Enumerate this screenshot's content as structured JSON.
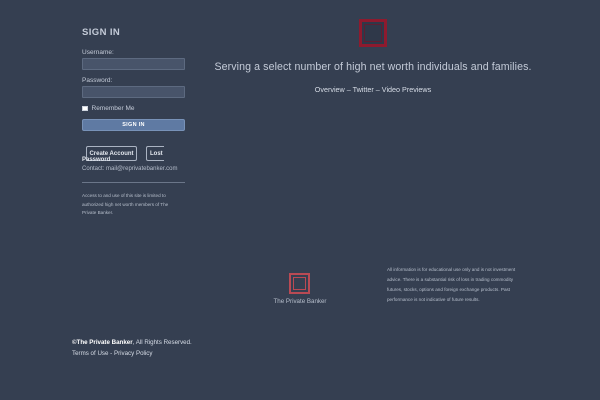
{
  "signin": {
    "title": "SIGN IN",
    "username_label": "Username:",
    "username_value": "",
    "password_label": "Password:",
    "password_value": "",
    "remember_label": "Remember Me",
    "button_label": "SIGN IN",
    "create_account_label": "Create Account",
    "lost_label": "Lost",
    "password_label_link": "Password",
    "contact_prefix": "Contact:",
    "contact_email": "mail@reprivatebanker.com",
    "access_notice": "Access to and use of this site is limited to authorized high net worth members of The Private Banker."
  },
  "hero": {
    "tagline": "Serving a select number of high net worth individuals and families.",
    "link_overview": "Overview",
    "link_twitter": "Twitter",
    "link_video": "Video Previews",
    "separator": "–"
  },
  "footer": {
    "brand": "The Private Banker",
    "disclaimer": "All information is for educational use only and is not investment advice. There is a substantial risk of loss in trading commodity futures, stocks, options and foreign exchange products. Past performance is not indicative of future results.",
    "copyright_brand": "©The Private Banker",
    "copyright_rest": ", All Rights Reserved.",
    "terms_label": "Terms of Use",
    "legal_separator": " - ",
    "privacy_label": "Privacy Policy"
  },
  "colors": {
    "background": "#353f51",
    "accent_logo": "#8e1a2e",
    "footer_logo": "#b94a54",
    "button": "#5f7aa3"
  }
}
